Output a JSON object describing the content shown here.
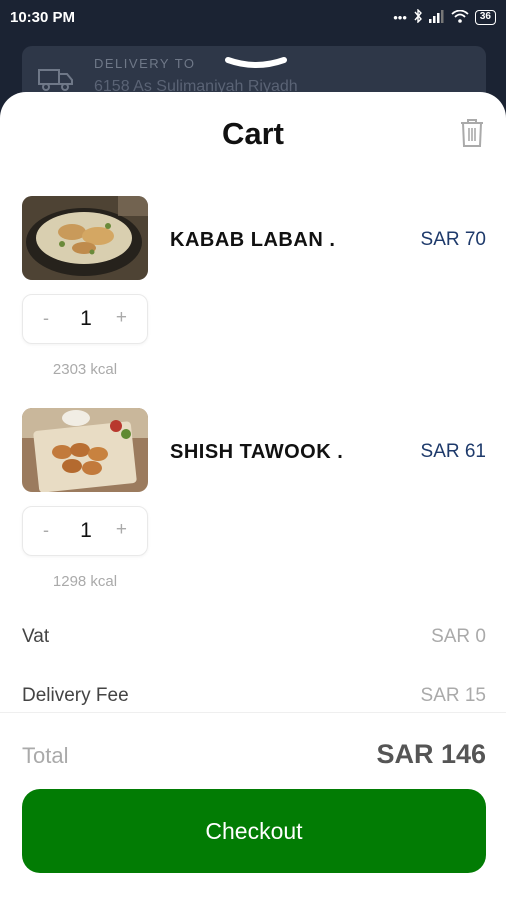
{
  "status_bar": {
    "time": "10:30 PM",
    "battery": "36"
  },
  "delivery": {
    "label": "DELIVERY TO",
    "address": "6158 As Sulimaniyah Riyadh"
  },
  "cart": {
    "title": "Cart",
    "items": [
      {
        "name": "KABAB LABAN .",
        "price": "SAR 70",
        "quantity": "1",
        "kcal": "2303 kcal"
      },
      {
        "name": "SHISH TAWOOK .",
        "price": "SAR 61",
        "quantity": "1",
        "kcal": "1298 kcal"
      }
    ],
    "stepper": {
      "minus": "-",
      "plus": "+"
    }
  },
  "summary": {
    "vat_label": "Vat",
    "vat_value": "SAR 0",
    "delivery_fee_label": "Delivery Fee",
    "delivery_fee_value": "SAR 15"
  },
  "footer": {
    "total_label": "Total",
    "total_value": "SAR 146",
    "checkout_label": "Checkout"
  },
  "colors": {
    "checkout_green": "#027c04",
    "price_navy": "#1e3a6b",
    "header_dark": "#1b2333"
  }
}
